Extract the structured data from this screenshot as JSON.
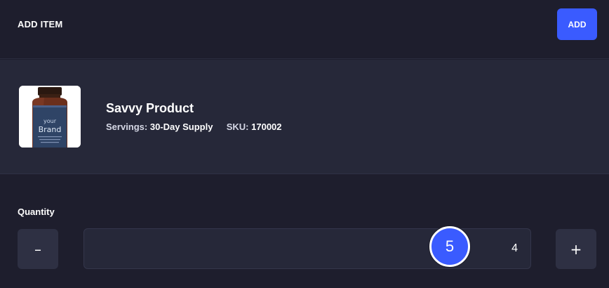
{
  "header": {
    "title": "ADD ITEM",
    "add_label": "ADD"
  },
  "product": {
    "name": "Savvy Product",
    "servings_label": "Servings:",
    "servings_value": "30-Day Supply",
    "sku_label": "SKU:",
    "sku_value": "170002",
    "image": {
      "brand_top": "your",
      "brand_name": "Brand"
    }
  },
  "quantity": {
    "label": "Quantity",
    "value": "4",
    "minus_symbol": "–",
    "plus_symbol": "+"
  },
  "step_marker": {
    "number": "5"
  },
  "colors": {
    "background": "#1e1e2d",
    "product_panel": "#262839",
    "accent": "#3a5bff"
  }
}
